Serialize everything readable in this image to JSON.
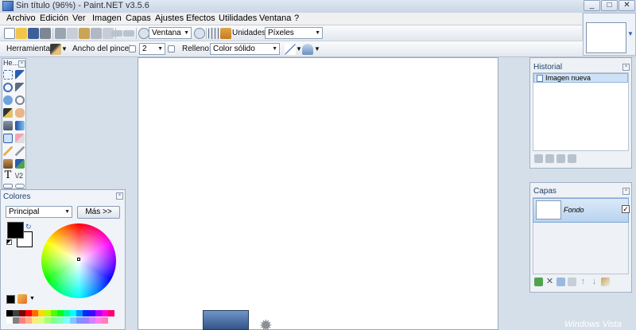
{
  "window": {
    "title": "Sin título (96%) - Paint.NET v3.5.6",
    "controls": [
      "_",
      "□",
      "✕"
    ]
  },
  "menu": [
    "Archivo",
    "Edición",
    "Ver",
    "Imagen",
    "Capas",
    "Ajustes",
    "Efectos",
    "Utilidades",
    "Ventana",
    "?"
  ],
  "toolbar1": {
    "zoom_combo": "Ventana",
    "units_label": "Unidades:",
    "units_combo": "Píxeles"
  },
  "toolbar2": {
    "tool_label": "Herramienta:",
    "brush_width_label": "Ancho del pincel:",
    "brush_width_value": "2",
    "fill_label": "Relleno:",
    "fill_combo": "Color sólido"
  },
  "tools": {
    "title": "He...",
    "tool_icons": [
      "select-rect",
      "move-selection",
      "zoom",
      "move-selected",
      "ellipse-select",
      "magic-wand",
      "magic-wand-2",
      "pan",
      "paint-bucket",
      "gradient",
      "paintbrush",
      "eraser",
      "pencil",
      "color-picker",
      "clone-stamp",
      "recolor",
      "text",
      "line",
      "rectangle",
      "rounded-rect"
    ]
  },
  "colors": {
    "title": "Colores",
    "mode_combo": "Principal",
    "more_button": "Más >>",
    "primary": "#000000",
    "secondary": "#ffffff",
    "palette": [
      "#000000",
      "#404040",
      "#800000",
      "#ff0000",
      "#ff6a00",
      "#ffd800",
      "#b6ff00",
      "#4cff00",
      "#00ff21",
      "#00ff90",
      "#00ffff",
      "#0094ff",
      "#0026ff",
      "#4800ff",
      "#b200ff",
      "#ff00dc",
      "#ff006e",
      "#ffffff",
      "#808080",
      "#ff7f7f",
      "#ffb27f",
      "#ffe97f",
      "#daff7f",
      "#a5ff7f",
      "#7fff8e",
      "#7fffc5",
      "#7fffff",
      "#7fc9ff",
      "#7f92ff",
      "#a17fff",
      "#d67fff",
      "#ff7fed",
      "#ff7fb6"
    ]
  },
  "history": {
    "title": "Historial",
    "items": [
      "Imagen nueva"
    ]
  },
  "layers": {
    "title": "Capas",
    "items": [
      {
        "name": "Fondo",
        "visible": true
      }
    ]
  },
  "taskbar": {
    "brand": "Windows Vista"
  },
  "colors_ui": {
    "accent": "#2b5db1",
    "selection": "#cfe1f6"
  }
}
